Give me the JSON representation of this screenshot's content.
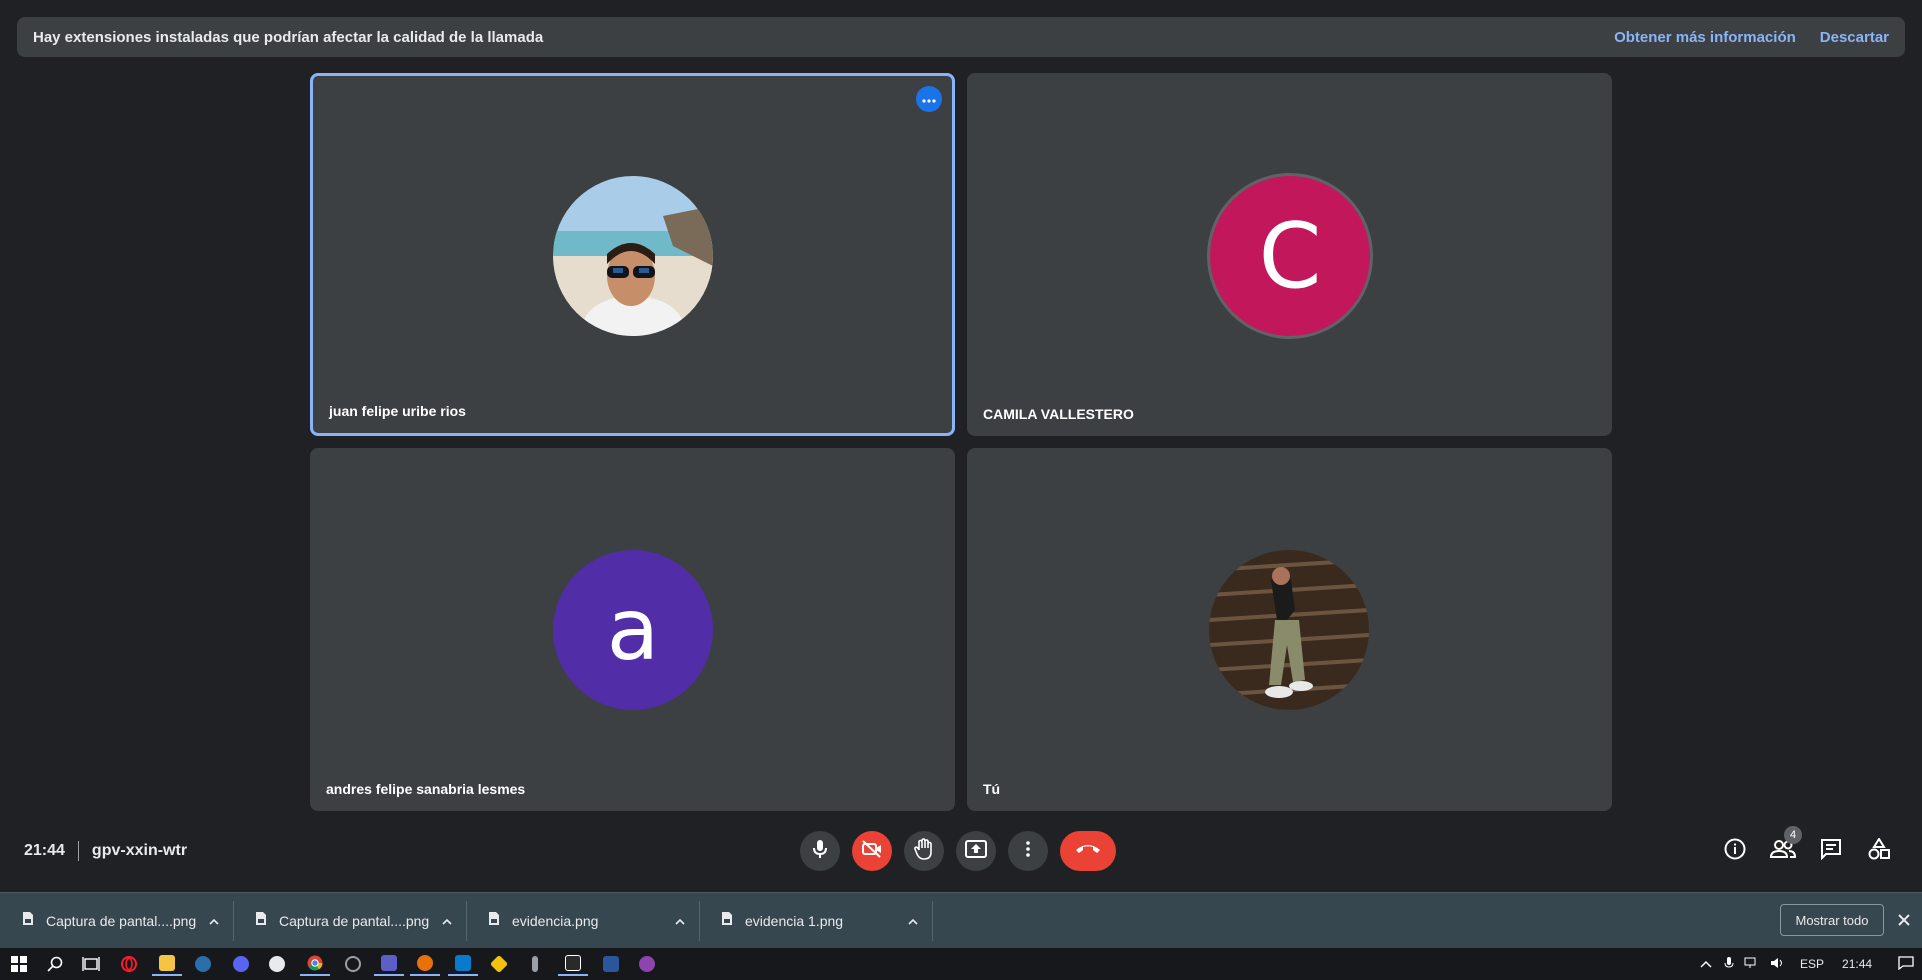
{
  "banner": {
    "message": "Hay extensiones instaladas que podrían afectar la calidad de la llamada",
    "learn_more": "Obtener más información",
    "dismiss": "Descartar"
  },
  "tiles": [
    {
      "name": "juan felipe uribe rios",
      "avatar_type": "photo-beach"
    },
    {
      "name": "CAMILA VALLESTERO",
      "avatar_letter": "C",
      "avatar_color": "#c2185b"
    },
    {
      "name": "andres felipe sanabria lesmes",
      "avatar_letter": "a",
      "avatar_color": "#512da8"
    },
    {
      "name": "Tú",
      "avatar_type": "photo-self"
    }
  ],
  "meeting": {
    "time": "21:44",
    "code": "gpv-xxin-wtr"
  },
  "controls": {
    "participants_count": "4",
    "colors": {
      "danger": "#ea4335",
      "accent": "#8ab4f8",
      "tile": "#3c4043",
      "background": "#202124"
    }
  },
  "downloads": {
    "items": [
      "Captura de pantal....png",
      "Captura de pantal....png",
      "evidencia.png",
      "evidencia 1.png"
    ],
    "show_all": "Mostrar todo"
  },
  "taskbar": {
    "language": "ESP",
    "clock": "21:44",
    "apps": [
      "windows-start",
      "search",
      "task-view",
      "opera",
      "file-explorer",
      "steam",
      "discord",
      "app-i",
      "chrome",
      "app-circle",
      "teams",
      "orange-app",
      "vscode",
      "git-app",
      "audio-app",
      "epic-games",
      "word",
      "github-desktop"
    ]
  }
}
